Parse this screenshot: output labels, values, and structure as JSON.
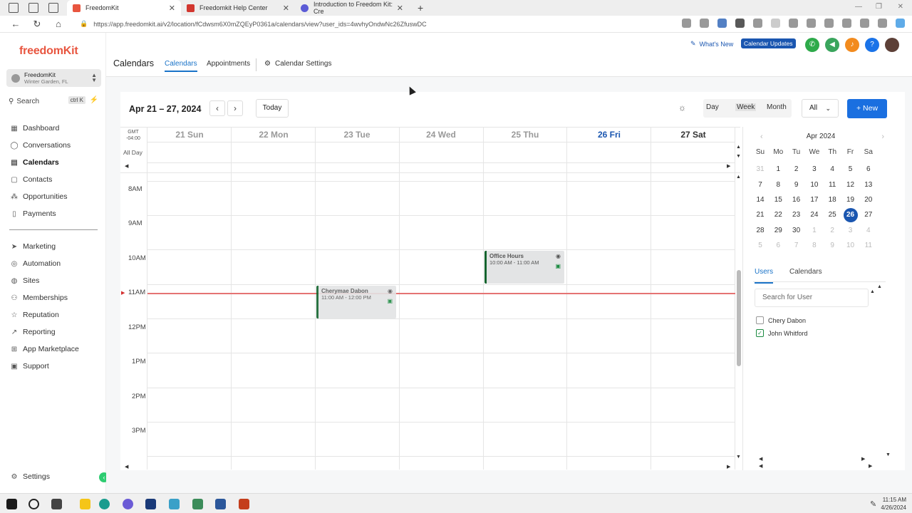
{
  "browser": {
    "tabs": [
      {
        "title": "FreedomKit",
        "color": "#e8553f",
        "active": true
      },
      {
        "title": "Freedomkit Help Center",
        "color": "#d2372f",
        "active": false
      },
      {
        "title": "Introduction to Freedom Kit: Cre",
        "color": "#5b5bd6",
        "active": false
      }
    ],
    "url": "https://app.freedomkit.ai/v2/location/fCdwsm6X0mZQEyP0361a/calendars/view?user_ids=4wvhyOndwNc26ZfuswDC"
  },
  "sidebar": {
    "logo": "freedomKit",
    "location_name": "FreedomKit",
    "location_city": "Winter Garden, FL",
    "search_label": "Search",
    "search_shortcut": "ctrl K",
    "items_top": [
      {
        "label": "Dashboard",
        "icon": "dashboard-icon"
      },
      {
        "label": "Conversations",
        "icon": "chat-icon"
      },
      {
        "label": "Calendars",
        "icon": "calendar-icon",
        "active": true
      },
      {
        "label": "Contacts",
        "icon": "contacts-icon"
      },
      {
        "label": "Opportunities",
        "icon": "opportunities-icon"
      },
      {
        "label": "Payments",
        "icon": "payments-icon"
      }
    ],
    "items_bottom": [
      {
        "label": "Marketing",
        "icon": "send-icon"
      },
      {
        "label": "Automation",
        "icon": "automation-icon"
      },
      {
        "label": "Sites",
        "icon": "globe-icon"
      },
      {
        "label": "Memberships",
        "icon": "membership-icon"
      },
      {
        "label": "Reputation",
        "icon": "star-icon"
      },
      {
        "label": "Reporting",
        "icon": "chart-icon"
      },
      {
        "label": "App Marketplace",
        "icon": "grid-icon"
      },
      {
        "label": "Support",
        "icon": "support-icon"
      }
    ],
    "settings_label": "Settings"
  },
  "topbar": {
    "title": "Calendars",
    "tabs": [
      "Calendars",
      "Appointments",
      "Calendar Settings"
    ],
    "whats_new": "What's New",
    "calendar_updates": "Calendar Updates"
  },
  "calendar": {
    "range": "Apr 21 – 27, 2024",
    "today_label": "Today",
    "views": [
      "Day",
      "Week",
      "Month"
    ],
    "filter": "All",
    "new_label": "+ New",
    "gmt": "GMT -04:00",
    "all_day": "All Day",
    "days": [
      "21 Sun",
      "22 Mon",
      "23 Tue",
      "24 Wed",
      "25 Thu",
      "26 Fri",
      "27 Sat"
    ],
    "hours": [
      "8AM",
      "9AM",
      "10AM",
      "11AM",
      "12PM",
      "1PM",
      "2PM",
      "3PM"
    ],
    "events": [
      {
        "title": "Office Hours",
        "time": "10:00 AM - 11:00 AM"
      },
      {
        "title": "Cherymae Dabon",
        "time": "11:00 AM - 12:00 PM"
      }
    ]
  },
  "mini_calendar": {
    "month": "Apr 2024",
    "weekdays": [
      "Su",
      "Mo",
      "Tu",
      "We",
      "Th",
      "Fr",
      "Sa"
    ],
    "weeks": [
      [
        "31",
        "1",
        "2",
        "3",
        "4",
        "5",
        "6"
      ],
      [
        "7",
        "8",
        "9",
        "10",
        "11",
        "12",
        "13"
      ],
      [
        "14",
        "15",
        "16",
        "17",
        "18",
        "19",
        "20"
      ],
      [
        "21",
        "22",
        "23",
        "24",
        "25",
        "26",
        "27"
      ],
      [
        "28",
        "29",
        "30",
        "1",
        "2",
        "3",
        "4"
      ],
      [
        "5",
        "6",
        "7",
        "8",
        "9",
        "10",
        "11"
      ]
    ],
    "selected": "26"
  },
  "right_panel": {
    "tabs": [
      "Users",
      "Calendars"
    ],
    "search_placeholder": "Search for User",
    "users": [
      {
        "name": "Chery Dabon",
        "checked": false
      },
      {
        "name": "John Whitford",
        "checked": true
      }
    ]
  },
  "taskbar": {
    "time": "11:15 AM",
    "date": "4/26/2024"
  }
}
